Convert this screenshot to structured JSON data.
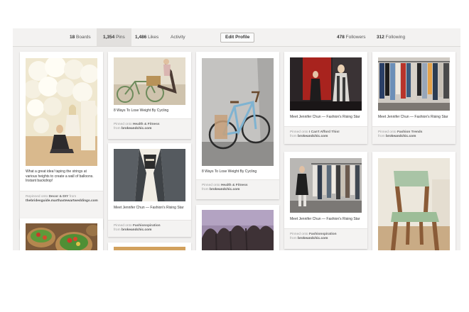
{
  "profile_nav": {
    "boards": {
      "count": "18",
      "label": "Boards"
    },
    "pins": {
      "count": "1,354",
      "label": "Pins"
    },
    "likes": {
      "count": "1,486",
      "label": "Likes"
    },
    "activity": "Activity",
    "edit_profile": "Edit Profile",
    "followers": {
      "count": "478",
      "label": "Followers"
    },
    "following": {
      "count": "312",
      "label": "Following"
    }
  },
  "pins": [
    {
      "description": "What a great idea! taping the strings at various heights to create a wall of balloons. Instant backdrop!",
      "pin_verb": "Repinned onto",
      "board": "Decor & DIY",
      "from_word": "from",
      "source": "thebridesguide.marthastewartweddings.com"
    },
    {
      "description": "8 Ways To Lose Weight By Cycling",
      "pin_verb": "Pinned onto",
      "board": "Health & Fitness",
      "from_word": "from",
      "source": "brokeandchic.com"
    },
    {
      "description": "Meet Jennifer Chun — Fashion's Rising Star",
      "pin_verb": "Pinned onto",
      "board": "Fashionspiration",
      "from_word": "from",
      "source": "brokeandchic.com"
    },
    {
      "description": "8 Ways To Lose Weight By Cycling",
      "pin_verb": "Pinned onto",
      "board": "Health & Fitness",
      "from_word": "from",
      "source": "brokeandchic.com"
    },
    {
      "description": "Meet Jennifer Chun — Fashion's Rising Star",
      "pin_verb": "Pinned onto",
      "board": "I Can't Afford This!",
      "from_word": "from",
      "source": "brokeandchic.com"
    },
    {
      "description": "Meet Jennifer Chun — Fashion's Rising Star",
      "pin_verb": "Pinned onto",
      "board": "Fashionspiration",
      "from_word": "from",
      "source": "brokeandchic.com"
    },
    {
      "description": "Meet Jennifer Chun — Fashion's Rising Star",
      "pin_verb": "Pinned onto",
      "board": "Fashion Trends",
      "from_word": "from",
      "source": "brokeandchic.com"
    }
  ]
}
